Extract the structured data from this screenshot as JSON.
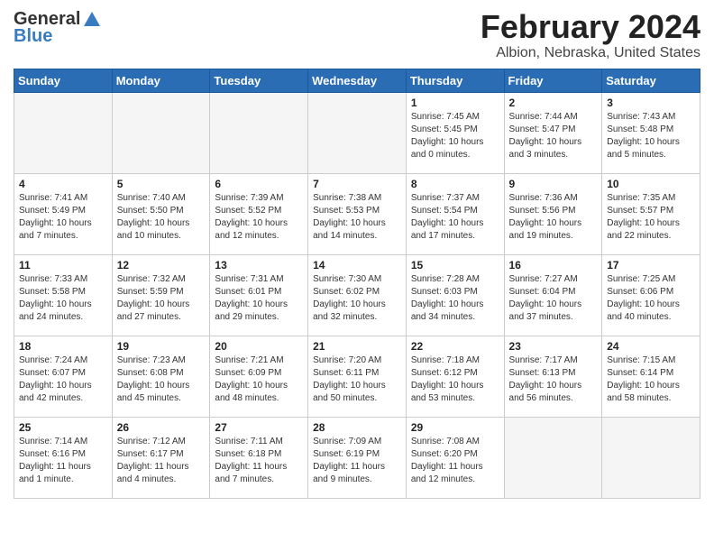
{
  "header": {
    "logo_general": "General",
    "logo_blue": "Blue",
    "month_title": "February 2024",
    "location": "Albion, Nebraska, United States"
  },
  "weekdays": [
    "Sunday",
    "Monday",
    "Tuesday",
    "Wednesday",
    "Thursday",
    "Friday",
    "Saturday"
  ],
  "weeks": [
    [
      {
        "day": "",
        "info": ""
      },
      {
        "day": "",
        "info": ""
      },
      {
        "day": "",
        "info": ""
      },
      {
        "day": "",
        "info": ""
      },
      {
        "day": "1",
        "info": "Sunrise: 7:45 AM\nSunset: 5:45 PM\nDaylight: 10 hours\nand 0 minutes."
      },
      {
        "day": "2",
        "info": "Sunrise: 7:44 AM\nSunset: 5:47 PM\nDaylight: 10 hours\nand 3 minutes."
      },
      {
        "day": "3",
        "info": "Sunrise: 7:43 AM\nSunset: 5:48 PM\nDaylight: 10 hours\nand 5 minutes."
      }
    ],
    [
      {
        "day": "4",
        "info": "Sunrise: 7:41 AM\nSunset: 5:49 PM\nDaylight: 10 hours\nand 7 minutes."
      },
      {
        "day": "5",
        "info": "Sunrise: 7:40 AM\nSunset: 5:50 PM\nDaylight: 10 hours\nand 10 minutes."
      },
      {
        "day": "6",
        "info": "Sunrise: 7:39 AM\nSunset: 5:52 PM\nDaylight: 10 hours\nand 12 minutes."
      },
      {
        "day": "7",
        "info": "Sunrise: 7:38 AM\nSunset: 5:53 PM\nDaylight: 10 hours\nand 14 minutes."
      },
      {
        "day": "8",
        "info": "Sunrise: 7:37 AM\nSunset: 5:54 PM\nDaylight: 10 hours\nand 17 minutes."
      },
      {
        "day": "9",
        "info": "Sunrise: 7:36 AM\nSunset: 5:56 PM\nDaylight: 10 hours\nand 19 minutes."
      },
      {
        "day": "10",
        "info": "Sunrise: 7:35 AM\nSunset: 5:57 PM\nDaylight: 10 hours\nand 22 minutes."
      }
    ],
    [
      {
        "day": "11",
        "info": "Sunrise: 7:33 AM\nSunset: 5:58 PM\nDaylight: 10 hours\nand 24 minutes."
      },
      {
        "day": "12",
        "info": "Sunrise: 7:32 AM\nSunset: 5:59 PM\nDaylight: 10 hours\nand 27 minutes."
      },
      {
        "day": "13",
        "info": "Sunrise: 7:31 AM\nSunset: 6:01 PM\nDaylight: 10 hours\nand 29 minutes."
      },
      {
        "day": "14",
        "info": "Sunrise: 7:30 AM\nSunset: 6:02 PM\nDaylight: 10 hours\nand 32 minutes."
      },
      {
        "day": "15",
        "info": "Sunrise: 7:28 AM\nSunset: 6:03 PM\nDaylight: 10 hours\nand 34 minutes."
      },
      {
        "day": "16",
        "info": "Sunrise: 7:27 AM\nSunset: 6:04 PM\nDaylight: 10 hours\nand 37 minutes."
      },
      {
        "day": "17",
        "info": "Sunrise: 7:25 AM\nSunset: 6:06 PM\nDaylight: 10 hours\nand 40 minutes."
      }
    ],
    [
      {
        "day": "18",
        "info": "Sunrise: 7:24 AM\nSunset: 6:07 PM\nDaylight: 10 hours\nand 42 minutes."
      },
      {
        "day": "19",
        "info": "Sunrise: 7:23 AM\nSunset: 6:08 PM\nDaylight: 10 hours\nand 45 minutes."
      },
      {
        "day": "20",
        "info": "Sunrise: 7:21 AM\nSunset: 6:09 PM\nDaylight: 10 hours\nand 48 minutes."
      },
      {
        "day": "21",
        "info": "Sunrise: 7:20 AM\nSunset: 6:11 PM\nDaylight: 10 hours\nand 50 minutes."
      },
      {
        "day": "22",
        "info": "Sunrise: 7:18 AM\nSunset: 6:12 PM\nDaylight: 10 hours\nand 53 minutes."
      },
      {
        "day": "23",
        "info": "Sunrise: 7:17 AM\nSunset: 6:13 PM\nDaylight: 10 hours\nand 56 minutes."
      },
      {
        "day": "24",
        "info": "Sunrise: 7:15 AM\nSunset: 6:14 PM\nDaylight: 10 hours\nand 58 minutes."
      }
    ],
    [
      {
        "day": "25",
        "info": "Sunrise: 7:14 AM\nSunset: 6:16 PM\nDaylight: 11 hours\nand 1 minute."
      },
      {
        "day": "26",
        "info": "Sunrise: 7:12 AM\nSunset: 6:17 PM\nDaylight: 11 hours\nand 4 minutes."
      },
      {
        "day": "27",
        "info": "Sunrise: 7:11 AM\nSunset: 6:18 PM\nDaylight: 11 hours\nand 7 minutes."
      },
      {
        "day": "28",
        "info": "Sunrise: 7:09 AM\nSunset: 6:19 PM\nDaylight: 11 hours\nand 9 minutes."
      },
      {
        "day": "29",
        "info": "Sunrise: 7:08 AM\nSunset: 6:20 PM\nDaylight: 11 hours\nand 12 minutes."
      },
      {
        "day": "",
        "info": ""
      },
      {
        "day": "",
        "info": ""
      }
    ]
  ]
}
